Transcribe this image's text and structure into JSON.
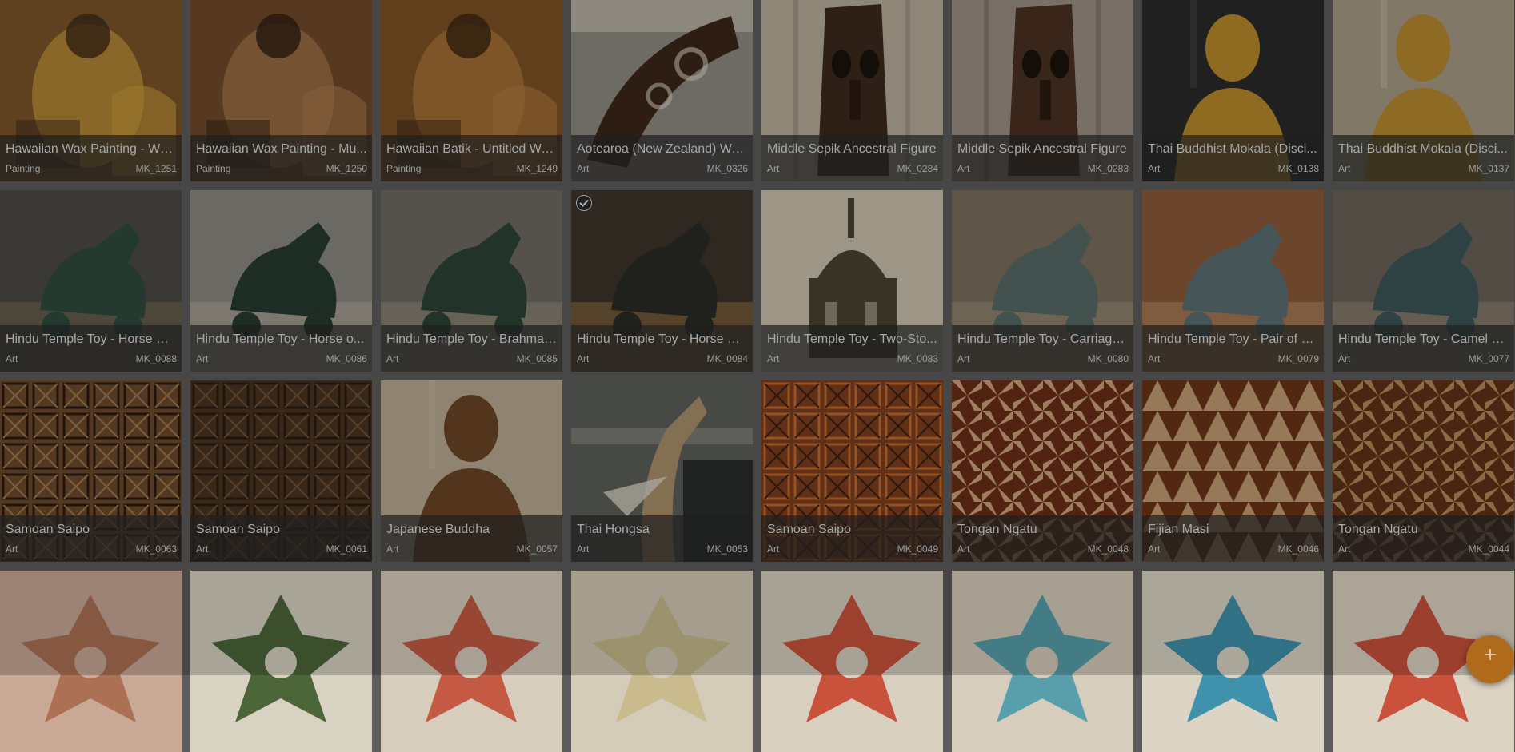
{
  "colors": {
    "background": "#5c5c5c",
    "caption_overlay": "#282828",
    "fab": "#b06a1c"
  },
  "fab": {
    "icon": "plus-icon",
    "symbol": "+"
  },
  "tiles": [
    {
      "title": "Hawaiian Wax Painting - Wo...",
      "category": "Painting",
      "code": "MK_1251",
      "palette": [
        "#7a5328",
        "#c79a3a",
        "#3e2a18"
      ],
      "kind": "painting"
    },
    {
      "title": "Hawaiian Wax Painting - Mu...",
      "category": "Painting",
      "code": "MK_1250",
      "palette": [
        "#6f4a2a",
        "#a8784c",
        "#2e1d10"
      ],
      "kind": "painting"
    },
    {
      "title": "Hawaiian Batik - Untitled Wa...",
      "category": "Painting",
      "code": "MK_1249",
      "palette": [
        "#7d5126",
        "#b07a3c",
        "#3a2410"
      ],
      "kind": "painting"
    },
    {
      "title": "Aotearoa (New Zealand) Wa...",
      "category": "Art",
      "code": "MK_0326",
      "palette": [
        "#8e8a80",
        "#3b2618",
        "#d9d3c3"
      ],
      "kind": "carving"
    },
    {
      "title": "Middle Sepik Ancestral Figure",
      "category": "Art",
      "code": "MK_0284",
      "palette": [
        "#b7ad9a",
        "#3c2a1e",
        "#8a8276"
      ],
      "kind": "mask"
    },
    {
      "title": "Middle Sepik Ancestral Figure",
      "category": "Art",
      "code": "MK_0283",
      "palette": [
        "#9a9084",
        "#4a3022",
        "#6e6458"
      ],
      "kind": "mask"
    },
    {
      "title": "Thai Buddhist Mokala (Disci...",
      "category": "Art",
      "code": "MK_0138",
      "palette": [
        "#2a2a2a",
        "#b88a2c",
        "#5a5a58"
      ],
      "kind": "statue"
    },
    {
      "title": "Thai Buddhist Mokala (Disci...",
      "category": "Art",
      "code": "MK_0137",
      "palette": [
        "#a79a84",
        "#b58a30",
        "#d8cdb8"
      ],
      "kind": "statue"
    },
    {
      "title": "Hindu Temple Toy - Horse Dr...",
      "category": "Art",
      "code": "MK_0088",
      "palette": [
        "#4c4a44",
        "#2f4a3e",
        "#8a7a60"
      ],
      "kind": "toy"
    },
    {
      "title": "Hindu Temple Toy - Horse o...",
      "category": "Art",
      "code": "MK_0086",
      "palette": [
        "#8a8780",
        "#26392f",
        "#bdb6a8"
      ],
      "kind": "toy"
    },
    {
      "title": "Hindu Temple Toy - Brahma ...",
      "category": "Art",
      "code": "MK_0085",
      "palette": [
        "#6e6a62",
        "#2c4236",
        "#a69c88"
      ],
      "kind": "toy"
    },
    {
      "title": "Hindu Temple Toy - Horse wi...",
      "category": "Art",
      "code": "MK_0084",
      "palette": [
        "#3c342a",
        "#2a2a24",
        "#b58a4a"
      ],
      "kind": "toy",
      "selected": true
    },
    {
      "title": "Hindu Temple Toy - Two-Sto...",
      "category": "Art",
      "code": "MK_0083",
      "palette": [
        "#8c8474",
        "#4a4230",
        "#c9c1ae"
      ],
      "kind": "temple"
    },
    {
      "title": "Hindu Temple Toy - Carriage...",
      "category": "Art",
      "code": "MK_0080",
      "palette": [
        "#7a6e5e",
        "#586a66",
        "#a89c86"
      ],
      "kind": "toy"
    },
    {
      "title": "Hindu Temple Toy - Pair of D...",
      "category": "Art",
      "code": "MK_0079",
      "palette": [
        "#8a5a3a",
        "#5a6e70",
        "#c8a27a"
      ],
      "kind": "toy"
    },
    {
      "title": "Hindu Temple Toy - Camel w...",
      "category": "Art",
      "code": "MK_0077",
      "palette": [
        "#6a6258",
        "#3c5456",
        "#a89884"
      ],
      "kind": "toy"
    },
    {
      "title": "Samoan Saipo",
      "category": "Art",
      "code": "MK_0063",
      "palette": [
        "#6b4a2c",
        "#2a1a0e",
        "#a07a4e"
      ],
      "kind": "tapa"
    },
    {
      "title": "Samoan Saipo",
      "category": "Art",
      "code": "MK_0061",
      "palette": [
        "#4a3420",
        "#2a1c10",
        "#6e5236"
      ],
      "kind": "tapa"
    },
    {
      "title": "Japanese Buddha",
      "category": "Art",
      "code": "MK_0057",
      "palette": [
        "#b8aa92",
        "#6a4424",
        "#d6cab4"
      ],
      "kind": "statue"
    },
    {
      "title": "Thai Hongsa",
      "category": "Art",
      "code": "MK_0053",
      "palette": [
        "#5a5e58",
        "#a8906a",
        "#2a2e2c"
      ],
      "kind": "hongsa"
    },
    {
      "title": "Samoan Saipo",
      "category": "Art",
      "code": "MK_0049",
      "palette": [
        "#7a3e1e",
        "#c06a2c",
        "#3a1e10"
      ],
      "kind": "tapa"
    },
    {
      "title": "Tongan Ngatu",
      "category": "Art",
      "code": "MK_0048",
      "palette": [
        "#6a2e18",
        "#caa27a",
        "#3e1a0c"
      ],
      "kind": "ngatu"
    },
    {
      "title": "Fijian Masi",
      "category": "Art",
      "code": "MK_0046",
      "palette": [
        "#6a3418",
        "#d6b58a",
        "#2a140a"
      ],
      "kind": "masi"
    },
    {
      "title": "Tongan Ngatu",
      "category": "Art",
      "code": "MK_0044",
      "palette": [
        "#5e3018",
        "#b08a5a",
        "#2e160a"
      ],
      "kind": "ngatu"
    },
    {
      "palette": [
        "#c9a896",
        "#a86a4e"
      ],
      "kind": "quilt"
    },
    {
      "palette": [
        "#d8d2c2",
        "#3e5a2a"
      ],
      "kind": "quilt"
    },
    {
      "palette": [
        "#d6cdbd",
        "#c24e36"
      ],
      "kind": "quilt"
    },
    {
      "palette": [
        "#d4cbb8",
        "#c9b98a"
      ],
      "kind": "quilt"
    },
    {
      "palette": [
        "#d8cfbf",
        "#c8442e"
      ],
      "kind": "quilt"
    },
    {
      "palette": [
        "#d6cdbc",
        "#4a9aa8"
      ],
      "kind": "quilt"
    },
    {
      "palette": [
        "#dcd5c6",
        "#2e8aa8"
      ],
      "kind": "quilt"
    },
    {
      "palette": [
        "#dcd3c2",
        "#c8422c"
      ],
      "kind": "quilt"
    }
  ]
}
